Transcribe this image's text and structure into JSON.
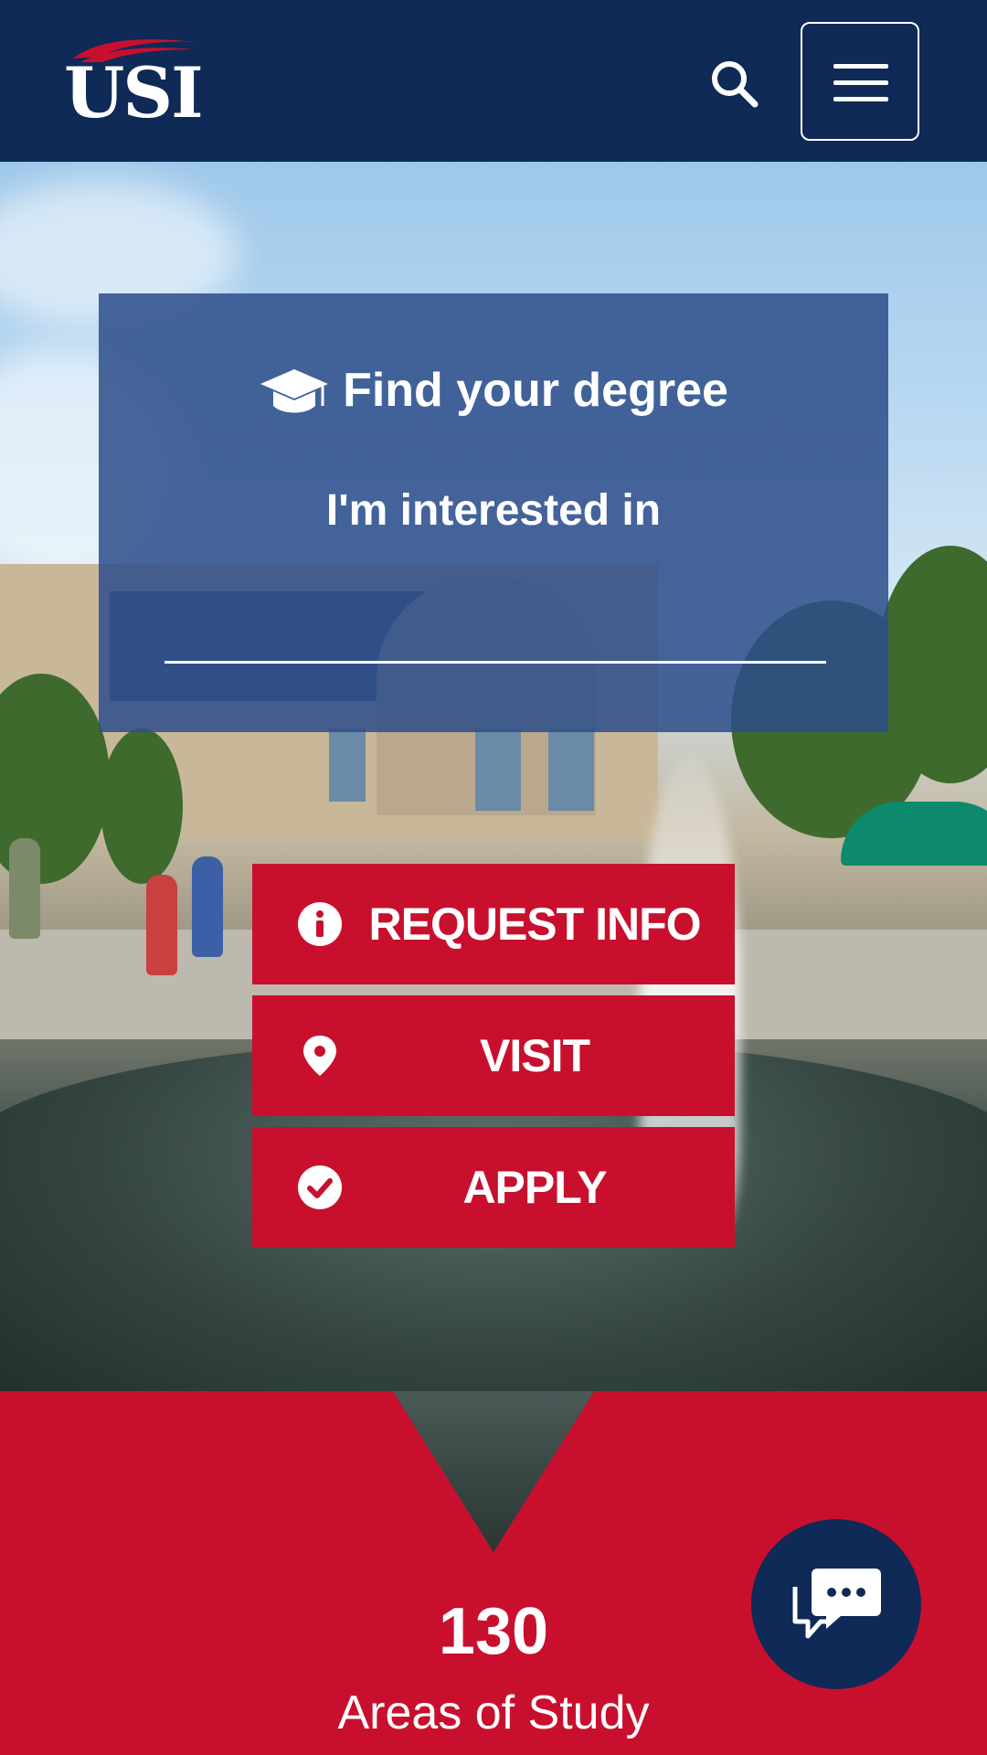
{
  "header": {
    "logo_text": "USI",
    "search_icon": "search-icon",
    "menu_icon": "hamburger-menu-icon"
  },
  "degree_search": {
    "title": "Find your degree",
    "title_icon": "graduation-cap-icon",
    "label": "I'm interested in",
    "input_value": "",
    "input_placeholder": ""
  },
  "cta_buttons": [
    {
      "label": "REQUEST INFO",
      "icon": "info-circle-icon"
    },
    {
      "label": "VISIT",
      "icon": "map-pin-icon"
    },
    {
      "label": "APPLY",
      "icon": "check-circle-icon"
    }
  ],
  "stats": {
    "number": "130",
    "label": "Areas of Study"
  },
  "chat": {
    "icon": "chat-bubbles-icon"
  },
  "colors": {
    "navy": "#0f2a57",
    "red": "#c8102e",
    "panel": "#2d4e8a",
    "white": "#ffffff"
  }
}
